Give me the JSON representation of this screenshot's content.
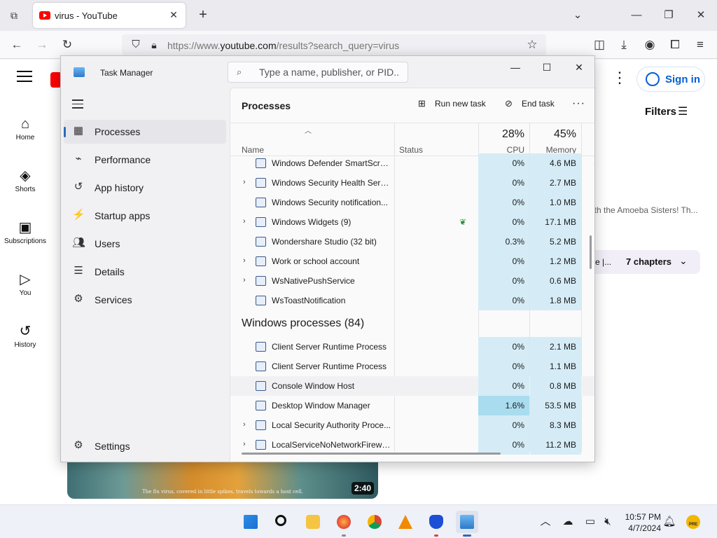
{
  "browser": {
    "tab_title": "virus - YouTube",
    "url_prefix": "https://www.",
    "url_domain": "youtube.com",
    "url_path": "/results?search_query=virus"
  },
  "youtube": {
    "sidebar": [
      {
        "label": "Home",
        "icon": "home-icon"
      },
      {
        "label": "Shorts",
        "icon": "shorts-icon"
      },
      {
        "label": "Subscriptions",
        "icon": "subscriptions-icon"
      },
      {
        "label": "You",
        "icon": "you-icon"
      },
      {
        "label": "History",
        "icon": "history-icon"
      }
    ],
    "sign_in": "Sign in",
    "filters": "Filters",
    "description_fragment": "ith the Amoeba Sisters! Th...",
    "chapters_fragment": "re |...",
    "chapters_label": "7 chapters",
    "thumbnail_caption": "The flu virus, covered in little spikes, travels towards a host cell.",
    "duration": "2:40"
  },
  "task_manager": {
    "title": "Task Manager",
    "search_placeholder": "Type a name, publisher, or PID...",
    "nav": [
      {
        "label": "Processes",
        "icon": "processes-icon",
        "active": true
      },
      {
        "label": "Performance",
        "icon": "performance-icon"
      },
      {
        "label": "App history",
        "icon": "app-history-icon"
      },
      {
        "label": "Startup apps",
        "icon": "startup-apps-icon"
      },
      {
        "label": "Users",
        "icon": "users-icon"
      },
      {
        "label": "Details",
        "icon": "details-icon"
      },
      {
        "label": "Services",
        "icon": "services-icon"
      }
    ],
    "settings": "Settings",
    "section_title": "Processes",
    "run_new_task": "Run new task",
    "end_task": "End task",
    "columns": {
      "name": "Name",
      "status": "Status",
      "cpu_pct": "28%",
      "cpu": "CPU",
      "memory_pct": "45%",
      "memory": "Memory"
    },
    "rows": [
      {
        "name": "Windows Defender SmartScreen",
        "cpu": "0%",
        "memory": "4.6 MB",
        "expand": false,
        "partial": true
      },
      {
        "name": "Windows Security Health Servi...",
        "cpu": "0%",
        "memory": "2.7 MB",
        "expand": true
      },
      {
        "name": "Windows Security notification...",
        "cpu": "0%",
        "memory": "1.0 MB",
        "expand": false
      },
      {
        "name": "Windows Widgets (9)",
        "cpu": "0%",
        "memory": "17.1 MB",
        "expand": true,
        "eco": true
      },
      {
        "name": "Wondershare Studio (32 bit)",
        "cpu": "0.3%",
        "memory": "5.2 MB",
        "expand": false
      },
      {
        "name": "Work or school account",
        "cpu": "0%",
        "memory": "1.2 MB",
        "expand": true
      },
      {
        "name": "WsNativePushService",
        "cpu": "0%",
        "memory": "0.6 MB",
        "expand": true
      },
      {
        "name": "WsToastNotification",
        "cpu": "0%",
        "memory": "1.8 MB",
        "expand": false
      }
    ],
    "windows_processes_header": "Windows processes (84)",
    "windows_rows": [
      {
        "name": "Client Server Runtime Process",
        "cpu": "0%",
        "memory": "2.1 MB",
        "expand": false
      },
      {
        "name": "Client Server Runtime Process",
        "cpu": "0%",
        "memory": "1.1 MB",
        "expand": false
      },
      {
        "name": "Console Window Host",
        "cpu": "0%",
        "memory": "0.8 MB",
        "expand": false,
        "hover": true
      },
      {
        "name": "Desktop Window Manager",
        "cpu": "1.6%",
        "memory": "53.5 MB",
        "expand": false,
        "hot": true
      },
      {
        "name": "Local Security Authority Proce...",
        "cpu": "0%",
        "memory": "8.3 MB",
        "expand": true
      },
      {
        "name": "LocalServiceNoNetworkFirewa...",
        "cpu": "0%",
        "memory": "11.2 MB",
        "expand": true
      }
    ]
  },
  "taskbar": {
    "time": "10:57 PM",
    "date": "4/7/2024",
    "weather_badge": "PRE"
  },
  "colors": {
    "accent": "#2f6ab6",
    "cpu_cell": "#d5ecf6",
    "youtube_red": "#ff0000",
    "signin_blue": "#065fd4"
  }
}
